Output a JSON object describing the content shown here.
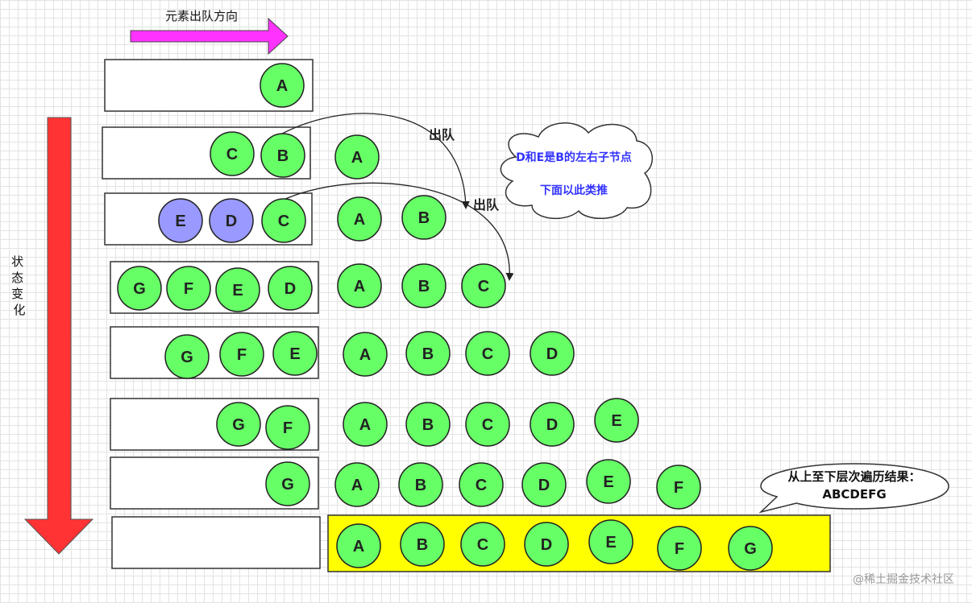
{
  "direction_label": "元素出队方向",
  "state_label": "状态变化",
  "dequeue_label_1": "出队",
  "dequeue_label_2": "出队",
  "cloud_note": {
    "line1": "D和E是B的左右子节点",
    "line2": "下面以此类推"
  },
  "result_note": {
    "line1": "从上至下层次遍历结果：",
    "line2": "ABCDEFG"
  },
  "watermark": "@稀土掘金技术社区",
  "rows": [
    {
      "queue": [
        "A"
      ],
      "output": []
    },
    {
      "queue": [
        "C",
        "B"
      ],
      "output": [
        "A"
      ]
    },
    {
      "queue": [
        "E",
        "D",
        "C"
      ],
      "output": [
        "A",
        "B"
      ]
    },
    {
      "queue": [
        "G",
        "F",
        "E",
        "D"
      ],
      "output": [
        "A",
        "B",
        "C"
      ]
    },
    {
      "queue": [
        "G",
        "F",
        "E"
      ],
      "output": [
        "A",
        "B",
        "C",
        "D"
      ]
    },
    {
      "queue": [
        "G",
        "F"
      ],
      "output": [
        "A",
        "B",
        "C",
        "D",
        "E"
      ]
    },
    {
      "queue": [
        "G"
      ],
      "output": [
        "A",
        "B",
        "C",
        "D",
        "E",
        "F"
      ]
    },
    {
      "queue": [],
      "output": [
        "A",
        "B",
        "C",
        "D",
        "E",
        "F",
        "G"
      ]
    }
  ],
  "colors": {
    "node_green": "#66ff66",
    "node_purple": "#9999ff",
    "highlight_yellow": "#ffff00",
    "arrow_magenta": "#ff33ff",
    "arrow_red": "#ff3333",
    "note_blue": "#3333ff"
  }
}
